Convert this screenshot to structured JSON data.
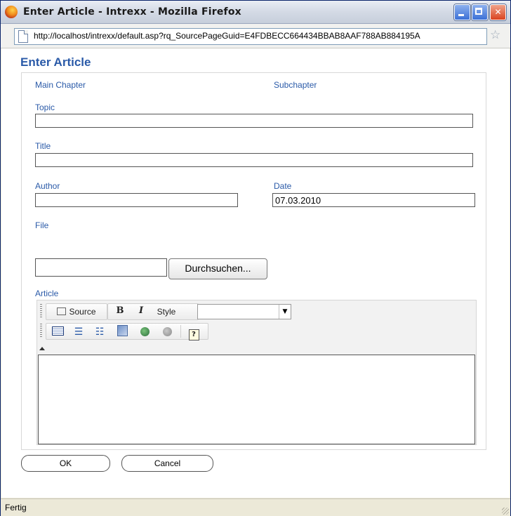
{
  "window": {
    "title": "Enter Article - Intrexx - Mozilla Firefox",
    "url": "http://localhost/intrexx/default.asp?rq_SourcePageGuid=E4FDBECC664434BBAB8AAF788AB884195A",
    "status": "Fertig"
  },
  "form": {
    "title": "Enter Article",
    "labels": {
      "main_chapter": "Main Chapter",
      "subchapter": "Subchapter",
      "topic": "Topic",
      "title": "Title",
      "author": "Author",
      "date": "Date",
      "file": "File",
      "article": "Article"
    },
    "values": {
      "topic": "",
      "title": "",
      "author": "",
      "date": "07.03.2010",
      "file": ""
    },
    "browse_label": "Durchsuchen..."
  },
  "editor": {
    "source_label": "Source",
    "bold_label": "B",
    "italic_label": "I",
    "style_label": "Style",
    "style_value": ""
  },
  "buttons": {
    "ok": "OK",
    "cancel": "Cancel"
  }
}
